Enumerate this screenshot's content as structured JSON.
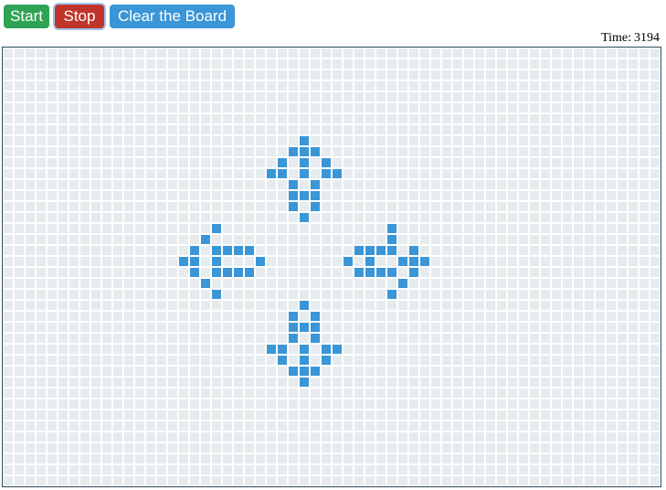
{
  "toolbar": {
    "start_label": "Start",
    "stop_label": "Stop",
    "clear_label": "Clear the Board"
  },
  "timer": {
    "label": "Time:",
    "value": "3194"
  },
  "board": {
    "columns": 60,
    "rows": 40,
    "live_cells": [
      [
        27,
        8
      ],
      [
        26,
        9
      ],
      [
        27,
        9
      ],
      [
        28,
        9
      ],
      [
        25,
        10
      ],
      [
        27,
        10
      ],
      [
        29,
        10
      ],
      [
        24,
        11
      ],
      [
        25,
        11
      ],
      [
        27,
        11
      ],
      [
        29,
        11
      ],
      [
        30,
        11
      ],
      [
        26,
        12
      ],
      [
        28,
        12
      ],
      [
        26,
        13
      ],
      [
        27,
        13
      ],
      [
        28,
        13
      ],
      [
        26,
        14
      ],
      [
        28,
        14
      ],
      [
        27,
        15
      ],
      [
        19,
        16
      ],
      [
        18,
        17
      ],
      [
        17,
        18
      ],
      [
        19,
        18
      ],
      [
        20,
        18
      ],
      [
        21,
        18
      ],
      [
        22,
        18
      ],
      [
        16,
        19
      ],
      [
        17,
        19
      ],
      [
        19,
        19
      ],
      [
        23,
        19
      ],
      [
        17,
        20
      ],
      [
        19,
        20
      ],
      [
        20,
        20
      ],
      [
        21,
        20
      ],
      [
        22,
        20
      ],
      [
        18,
        21
      ],
      [
        19,
        22
      ],
      [
        35,
        16
      ],
      [
        35,
        17
      ],
      [
        32,
        18
      ],
      [
        33,
        18
      ],
      [
        34,
        18
      ],
      [
        35,
        18
      ],
      [
        37,
        18
      ],
      [
        31,
        19
      ],
      [
        33,
        19
      ],
      [
        36,
        19
      ],
      [
        37,
        19
      ],
      [
        38,
        19
      ],
      [
        32,
        20
      ],
      [
        33,
        20
      ],
      [
        34,
        20
      ],
      [
        35,
        20
      ],
      [
        37,
        20
      ],
      [
        36,
        21
      ],
      [
        35,
        22
      ],
      [
        27,
        23
      ],
      [
        26,
        24
      ],
      [
        28,
        24
      ],
      [
        26,
        25
      ],
      [
        27,
        25
      ],
      [
        28,
        25
      ],
      [
        26,
        26
      ],
      [
        28,
        26
      ],
      [
        24,
        27
      ],
      [
        25,
        27
      ],
      [
        27,
        27
      ],
      [
        29,
        27
      ],
      [
        30,
        27
      ],
      [
        25,
        28
      ],
      [
        27,
        28
      ],
      [
        29,
        28
      ],
      [
        26,
        29
      ],
      [
        27,
        29
      ],
      [
        28,
        29
      ],
      [
        27,
        30
      ]
    ]
  },
  "colors": {
    "start_button": "#2fa354",
    "stop_button": "#c0352b",
    "clear_button": "#3a96d6",
    "live_cell": "#3a96d6",
    "dead_cell": "#e6ebee",
    "grid_background": "#ffffff"
  }
}
